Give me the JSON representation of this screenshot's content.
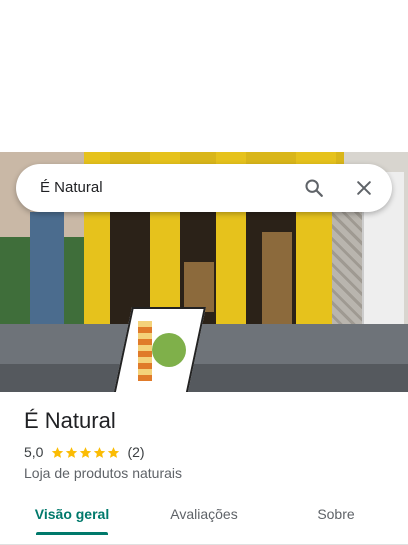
{
  "search": {
    "query": "É Natural"
  },
  "place": {
    "name": "É Natural",
    "rating": "5,0",
    "stars": 5,
    "review_count": "(2)",
    "category": "Loja de produtos naturais"
  },
  "tabs": [
    {
      "label": "Visão geral",
      "active": true
    },
    {
      "label": "Avaliações",
      "active": false
    },
    {
      "label": "Sobre",
      "active": false
    }
  ],
  "colors": {
    "accent": "#00796b",
    "star": "#fbbc04"
  },
  "icons": {
    "search": "search-icon",
    "close": "close-icon",
    "star": "star-icon"
  }
}
